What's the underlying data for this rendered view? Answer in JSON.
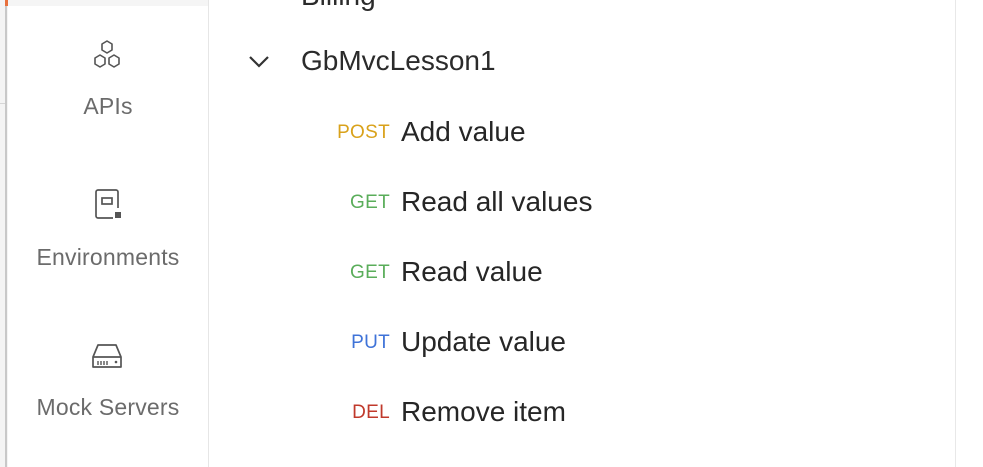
{
  "sidebar": {
    "items": [
      {
        "label": "APIs",
        "icon": "apis-icon"
      },
      {
        "label": "Environments",
        "icon": "environments-icon"
      },
      {
        "label": "Mock Servers",
        "icon": "mock-servers-icon"
      }
    ]
  },
  "tree": {
    "cut_off_folder": {
      "label": "Billing"
    },
    "folder": {
      "label": "GbMvcLesson1",
      "expanded": true
    },
    "requests": [
      {
        "method": "POST",
        "method_color": "#d9a21b",
        "name": "Add value"
      },
      {
        "method": "GET",
        "method_color": "#5aad5a",
        "name": "Read all values"
      },
      {
        "method": "GET",
        "method_color": "#5aad5a",
        "name": "Read value"
      },
      {
        "method": "PUT",
        "method_color": "#3f73d8",
        "name": "Update value"
      },
      {
        "method": "DEL",
        "method_color": "#c0392b",
        "name": "Remove item"
      }
    ]
  },
  "colors": {
    "accent": "#e8703d",
    "sidebar_text": "#6b6b6b",
    "tree_text": "#262626"
  }
}
